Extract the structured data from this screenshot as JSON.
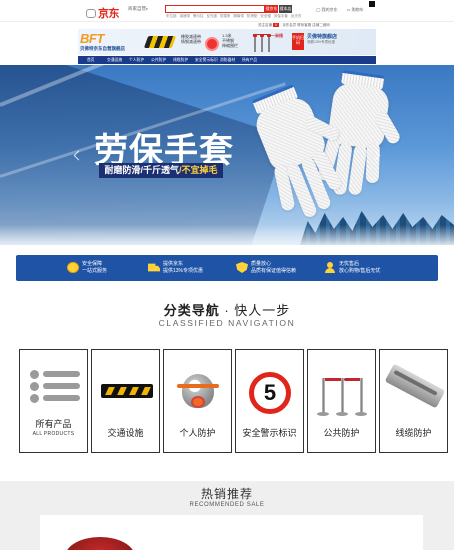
{
  "header": {
    "logo_text": "京东",
    "self_store_tag": "商家自营",
    "search_btn_jd": "搜京东",
    "search_btn_shop": "搜本店",
    "hot_words": [
      "车位锁",
      "减速带",
      "警示柱",
      "反光锥",
      "防撞条",
      "隔离带",
      "防滑垫",
      "安全帽",
      "劳保手套",
      "反光衣"
    ],
    "user_links": [
      "我的京东",
      "购物车"
    ],
    "sub_links": [
      "关注店铺",
      "京东会员",
      "联系客服",
      "店铺二维码"
    ],
    "sub_links_tag": "V"
  },
  "shop_banner": {
    "brand_logo": "BFT",
    "shop_name": "贝佛特京东自营旗舰店",
    "promo_speedbump": [
      "橡胶减速带",
      "铸钢减速带"
    ],
    "promo_disc": [
      "1.3米",
      "不锈钢",
      "伸缩围栏"
    ],
    "promo_posts_label": "一米线",
    "red_block": "手机扫码",
    "promo_shop": "贝佛特旗舰店",
    "promo_shop_sub": "领券13%专项优惠"
  },
  "nav": {
    "items": [
      "首页",
      "交通设施",
      "个人防护",
      "公共防护",
      "线缆防护",
      "安全警示标识",
      "消防器材",
      "所有产品"
    ]
  },
  "hero": {
    "title": "劳保手套",
    "subtitle_parts": [
      "耐磨防滑",
      "/千斤透气",
      "/不宜掉毛"
    ],
    "slide_count": 3,
    "active_slide": 2
  },
  "service": [
    {
      "icon": "coin-icon",
      "line1": "安全保障",
      "line2": "一站式服务"
    },
    {
      "icon": "truck-icon",
      "line1": "提供京东",
      "line2": "提供13%专项优惠"
    },
    {
      "icon": "shield-icon",
      "line1": "质量放心",
      "line2": "品质有保证值得信赖"
    },
    {
      "icon": "service-person-icon",
      "line1": "无忧售后",
      "line2": "放心购物/售后无忧"
    }
  ],
  "category_nav": {
    "title": "分类导航",
    "slogan": "快人一步",
    "subtitle_en": "CLASSIFIED NAVIGATION",
    "items": [
      {
        "label": "所有产品",
        "label_en": "ALL PRODUCTS",
        "icon": "list-icon"
      },
      {
        "label": "交通设施",
        "icon": "speed-bump-icon"
      },
      {
        "label": "个人防护",
        "icon": "gas-mask-icon"
      },
      {
        "label": "安全警示标识",
        "icon": "speed-limit-sign-icon"
      },
      {
        "label": "公共防护",
        "icon": "stanchion-icon"
      },
      {
        "label": "线缆防护",
        "icon": "cable-protector-icon"
      }
    ],
    "sign_number": "5"
  },
  "recommend": {
    "title": "热销推荐",
    "subtitle_en": "RECOMMENDED SALE"
  },
  "colors": {
    "jd_red": "#e1251b",
    "brand_blue": "#1a3a8a",
    "service_blue": "#1e53a6",
    "accent_yellow": "#ffd23a"
  }
}
